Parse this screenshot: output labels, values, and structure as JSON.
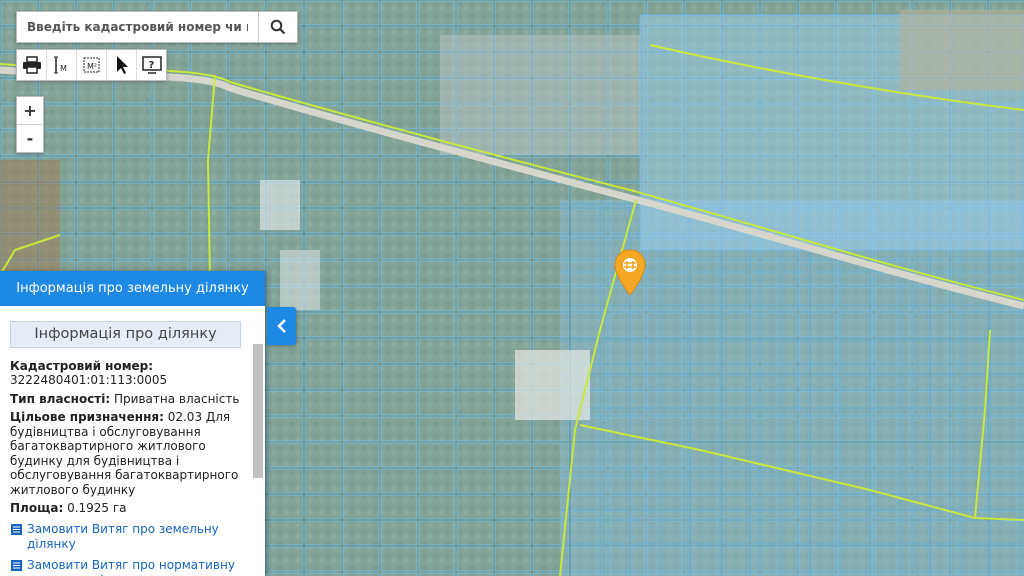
{
  "search": {
    "placeholder": "Введіть кадастровий номер чи населе"
  },
  "toolbar": {
    "tools": [
      "print-icon",
      "ruler-length-icon",
      "ruler-area-icon",
      "pointer-icon",
      "info-screen-icon"
    ]
  },
  "zoom": {
    "in": "+",
    "out": "-"
  },
  "panel": {
    "header": "Інформація про земельну ділянку",
    "subtitle": "Інформація про ділянку",
    "cadastral_label": "Кадастровий номер:",
    "cadastral_value": "3222480401:01:113:0005",
    "ownership_label": "Тип власності:",
    "ownership_value": "Приватна власність",
    "purpose_label": "Цільове призначення:",
    "purpose_value": "02.03 Для будівництва і обслуговування багатоквартирного житлового будинку для будівництва і обслуговування багатоквартирного житлового будинку",
    "area_label": "Площа:",
    "area_value": "0.1925 га",
    "link1": "Замовити Витяг про земельну ділянку",
    "link2": "Замовити Витяг про нормативну грошову оцінку"
  },
  "colors": {
    "accent": "#1e88e5",
    "parcel_fill": "#8ec9f2",
    "parcel_stroke": "#5aaee6",
    "boundary": "#cfe83a",
    "marker": "#f5a623"
  }
}
